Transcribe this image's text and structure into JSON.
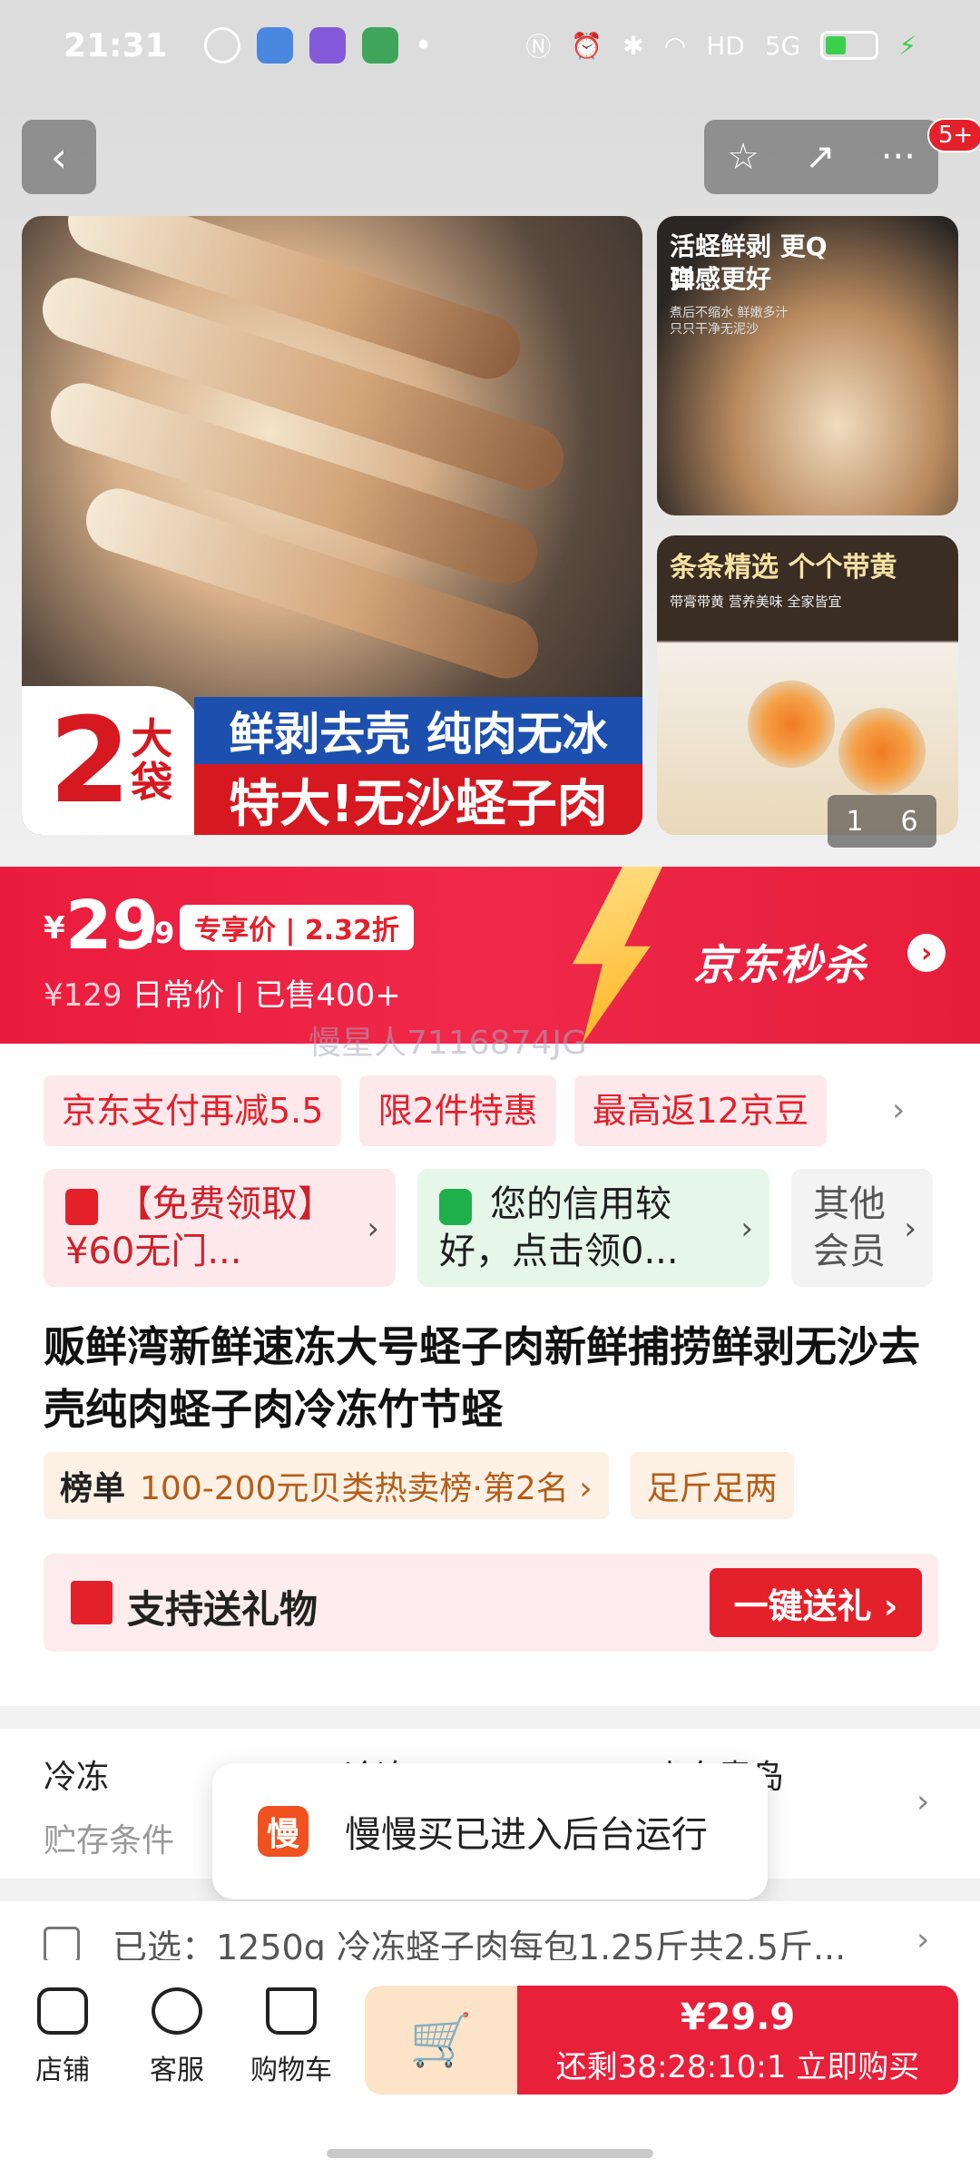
{
  "status_bar": {
    "time": "21:31",
    "network": "5G"
  },
  "nav": {
    "back_icon": "‹",
    "star_icon": "☆",
    "share_icon": "↗",
    "more_icon": "···",
    "more_badge": "5+"
  },
  "gallery": {
    "main_tag_big": "2",
    "main_tag_small": "大袋",
    "main_line1": "鲜剥去壳 纯肉无冰",
    "main_line2": "特大!无沙蛏子肉",
    "side1_line1": "活蛏鲜剥 更Q弹",
    "side1_line2": "口感更好",
    "side1_small": "煮后不缩水 鲜嫩多汁 只只干净无泥沙",
    "side2_line1": "条条精选 个个带黄",
    "side2_small": "带膏带黄 营养美味 全家皆宜",
    "pager_current": "1",
    "pager_total": "6"
  },
  "price": {
    "currency": "¥",
    "integer": "29",
    "decimal": ".9",
    "tag": "专享价 | 2.32折",
    "original": "¥129",
    "sub": "日常价 | 已售400+",
    "promo_brand": "京东秒杀"
  },
  "watermark": "慢星人7116874JG",
  "promos": [
    "京东支付再减5.5",
    "限2件特惠",
    "最高返12京豆"
  ],
  "cards": {
    "coupon": "【免费领取】¥60无门...",
    "credit": "您的信用较好，点击领0...",
    "member": "其他会员"
  },
  "product_title": "贩鲜湾新鲜速冻大号蛏子肉新鲜捕捞鲜剥无沙去壳纯肉蛏子肉冷冻竹节蛏",
  "rank": {
    "label": "榜单",
    "text": "100-200元贝类热卖榜·第2名 ›",
    "extra": "足斤足两"
  },
  "gift": {
    "label": "支持送礼物",
    "button": "一键送礼 ›"
  },
  "spec": {
    "storage_value": "冷冻",
    "storage_key": "贮存条件",
    "mid_value": "冷冻",
    "right_value": "山东青岛"
  },
  "toast": {
    "icon": "慢",
    "text": "慢慢买已进入后台运行"
  },
  "selected": {
    "text": "已选：1250g 冷冻蛏子肉每包1.25斤共2.5斤..."
  },
  "bottom": {
    "shop": "店铺",
    "service": "客服",
    "cart": "购物车",
    "add_cart_icon": "🛒",
    "buy_price": "¥29.9",
    "countdown": "还剩38:28:10:1  立即购买"
  },
  "colors": {
    "accent": "#e4202b",
    "price_bar": "#ea1c3d",
    "gift_bg": "#fdecee"
  }
}
